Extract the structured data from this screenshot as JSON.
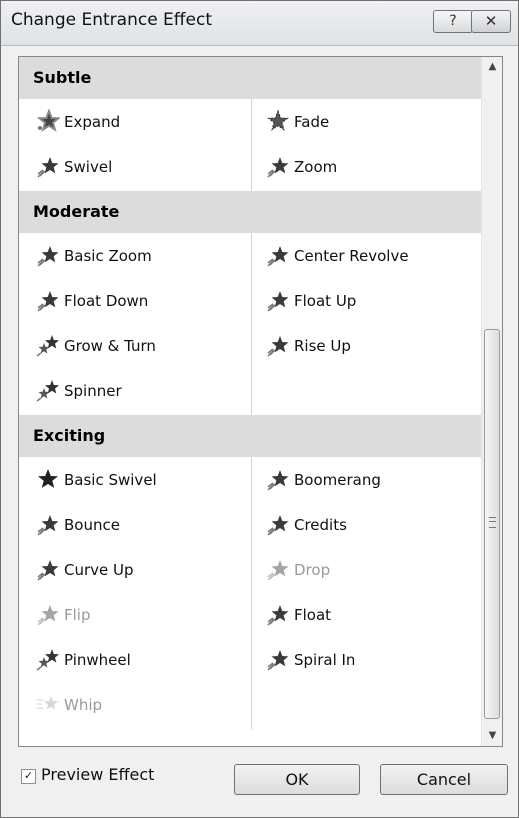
{
  "window": {
    "title": "Change Entrance Effect",
    "help_glyph": "?",
    "close_glyph": "✕"
  },
  "sections": [
    {
      "label": "Subtle",
      "items": [
        {
          "label": "Expand",
          "icon": "expand-star-icon",
          "enabled": true
        },
        {
          "label": "Fade",
          "icon": "fade-star-icon",
          "enabled": true
        },
        {
          "label": "Swivel",
          "icon": "star-icon",
          "enabled": true
        },
        {
          "label": "Zoom",
          "icon": "star-icon",
          "enabled": true
        }
      ]
    },
    {
      "label": "Moderate",
      "items": [
        {
          "label": "Basic Zoom",
          "icon": "star-icon",
          "enabled": true
        },
        {
          "label": "Center Revolve",
          "icon": "star-icon",
          "enabled": true
        },
        {
          "label": "Float Down",
          "icon": "star-icon",
          "enabled": true
        },
        {
          "label": "Float Up",
          "icon": "star-icon",
          "enabled": true
        },
        {
          "label": "Grow & Turn",
          "icon": "multi-star-icon",
          "enabled": true
        },
        {
          "label": "Rise Up",
          "icon": "star-icon",
          "enabled": true
        },
        {
          "label": "Spinner",
          "icon": "multi-star-icon",
          "enabled": true
        }
      ]
    },
    {
      "label": "Exciting",
      "items": [
        {
          "label": "Basic Swivel",
          "icon": "dark-star-icon",
          "enabled": true
        },
        {
          "label": "Boomerang",
          "icon": "star-icon",
          "enabled": true
        },
        {
          "label": "Bounce",
          "icon": "star-icon",
          "enabled": true
        },
        {
          "label": "Credits",
          "icon": "star-icon",
          "enabled": true
        },
        {
          "label": "Curve Up",
          "icon": "star-icon",
          "enabled": true
        },
        {
          "label": "Drop",
          "icon": "star-icon",
          "enabled": false
        },
        {
          "label": "Flip",
          "icon": "star-icon",
          "enabled": false
        },
        {
          "label": "Float",
          "icon": "star-icon",
          "enabled": true
        },
        {
          "label": "Pinwheel",
          "icon": "multi-star-icon",
          "enabled": true
        },
        {
          "label": "Spiral In",
          "icon": "star-icon",
          "enabled": true
        },
        {
          "label": "Whip",
          "icon": "whip-star-icon",
          "enabled": false
        }
      ]
    }
  ],
  "scrollbar": {
    "up_glyph": "▲",
    "down_glyph": "▼"
  },
  "footer": {
    "preview_checked": true,
    "preview_label": "Preview Effect",
    "ok_label": "OK",
    "cancel_label": "Cancel"
  }
}
